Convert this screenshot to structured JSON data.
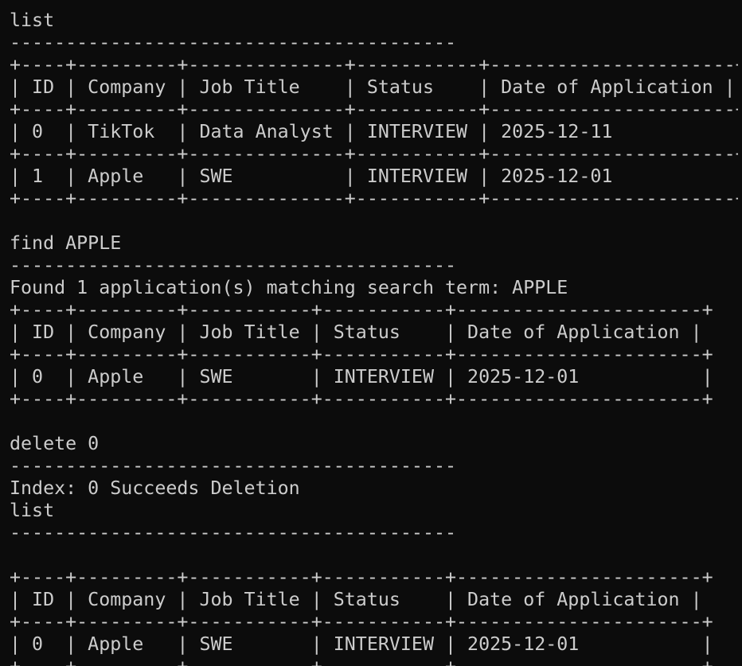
{
  "terminal": {
    "lines": [
      "list",
      "----------------------------------------",
      "+----+---------+--------------+-----------+----------------------+",
      "| ID | Company | Job Title    | Status    | Date of Application |",
      "+----+---------+--------------+-----------+----------------------+",
      "| 0  | TikTok  | Data Analyst | INTERVIEW | 2025-12-11           |",
      "+----+---------+--------------+-----------+----------------------+",
      "| 1  | Apple   | SWE          | INTERVIEW | 2025-12-01           |",
      "+----+---------+--------------+-----------+----------------------+",
      "",
      "find APPLE",
      "----------------------------------------",
      "Found 1 application(s) matching search term: APPLE",
      "+----+---------+-----------+-----------+----------------------+",
      "| ID | Company | Job Title | Status    | Date of Application |",
      "+----+---------+-----------+-----------+----------------------+",
      "| 0  | Apple   | SWE       | INTERVIEW | 2025-12-01           |",
      "+----+---------+-----------+-----------+----------------------+",
      "",
      "delete 0",
      "----------------------------------------",
      "Index: 0 Succeeds Deletion",
      "list",
      "----------------------------------------",
      "",
      "+----+---------+-----------+-----------+----------------------+",
      "| ID | Company | Job Title | Status    | Date of Application |",
      "+----+---------+-----------+-----------+----------------------+",
      "| 0  | Apple   | SWE       | INTERVIEW | 2025-12-01           |",
      "+----+---------+-----------+-----------+----------------------+"
    ]
  }
}
